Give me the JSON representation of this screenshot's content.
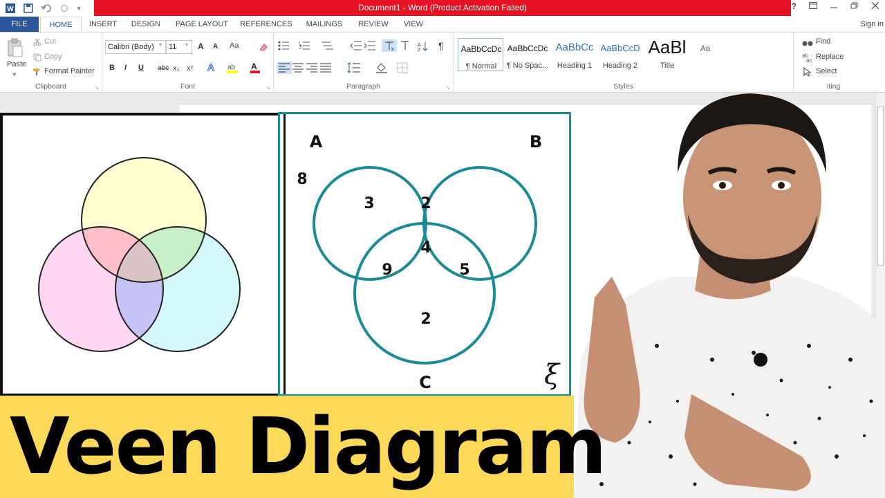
{
  "window": {
    "title": "Document1 - Word (Product Activation Failed)",
    "help_label": "?",
    "sign_in": "Sign in"
  },
  "tabs": [
    "FILE",
    "HOME",
    "INSERT",
    "DESIGN",
    "PAGE LAYOUT",
    "REFERENCES",
    "MAILINGS",
    "REVIEW",
    "VIEW"
  ],
  "clipboard": {
    "paste": "Paste",
    "cut": "Cut",
    "copy": "Copy",
    "format_painter": "Format Painter",
    "label": "Clipboard"
  },
  "font": {
    "family": "Calibri (Body)",
    "size": "11",
    "label": "Font",
    "grow": "A",
    "shrink": "A",
    "case": "Aa",
    "bold": "B",
    "italic": "I",
    "underline": "U",
    "strike": "abc",
    "sub": "x₂",
    "sup": "x²"
  },
  "paragraph": {
    "label": "Paragraph",
    "pilcrow": "¶"
  },
  "styles": {
    "label": "Styles",
    "items": [
      {
        "preview": "AaBbCcDc",
        "name": "¶ Normal"
      },
      {
        "preview": "AaBbCcDc",
        "name": "¶ No Spac..."
      },
      {
        "preview": "AaBbCc",
        "name": "Heading 1"
      },
      {
        "preview": "AaBbCcD",
        "name": "Heading 2"
      },
      {
        "preview": "AaBl",
        "name": "Title"
      },
      {
        "preview": "Aa",
        "name": ""
      }
    ]
  },
  "editing": {
    "find": "Find",
    "replace": "Replace",
    "select": "Select",
    "label": "Editing",
    "label_visible": "iting"
  },
  "venn_left": {
    "colors": {
      "top": "#fffbc8",
      "left": "#ffd0f0",
      "right": "#cdf6fb",
      "edge": "#222222"
    }
  },
  "venn_right": {
    "set_a": "A",
    "set_b": "B",
    "set_c": "C",
    "outside": "8",
    "only_a": "3",
    "a_and_b": "2",
    "all_three": "4",
    "a_and_c": "9",
    "b_and_c": "5",
    "only_c": "2",
    "universal_symbol": "ξ",
    "stroke": "#1b8a94"
  },
  "banner": {
    "text": "Veen Diagram",
    "background": "#fcd959"
  }
}
